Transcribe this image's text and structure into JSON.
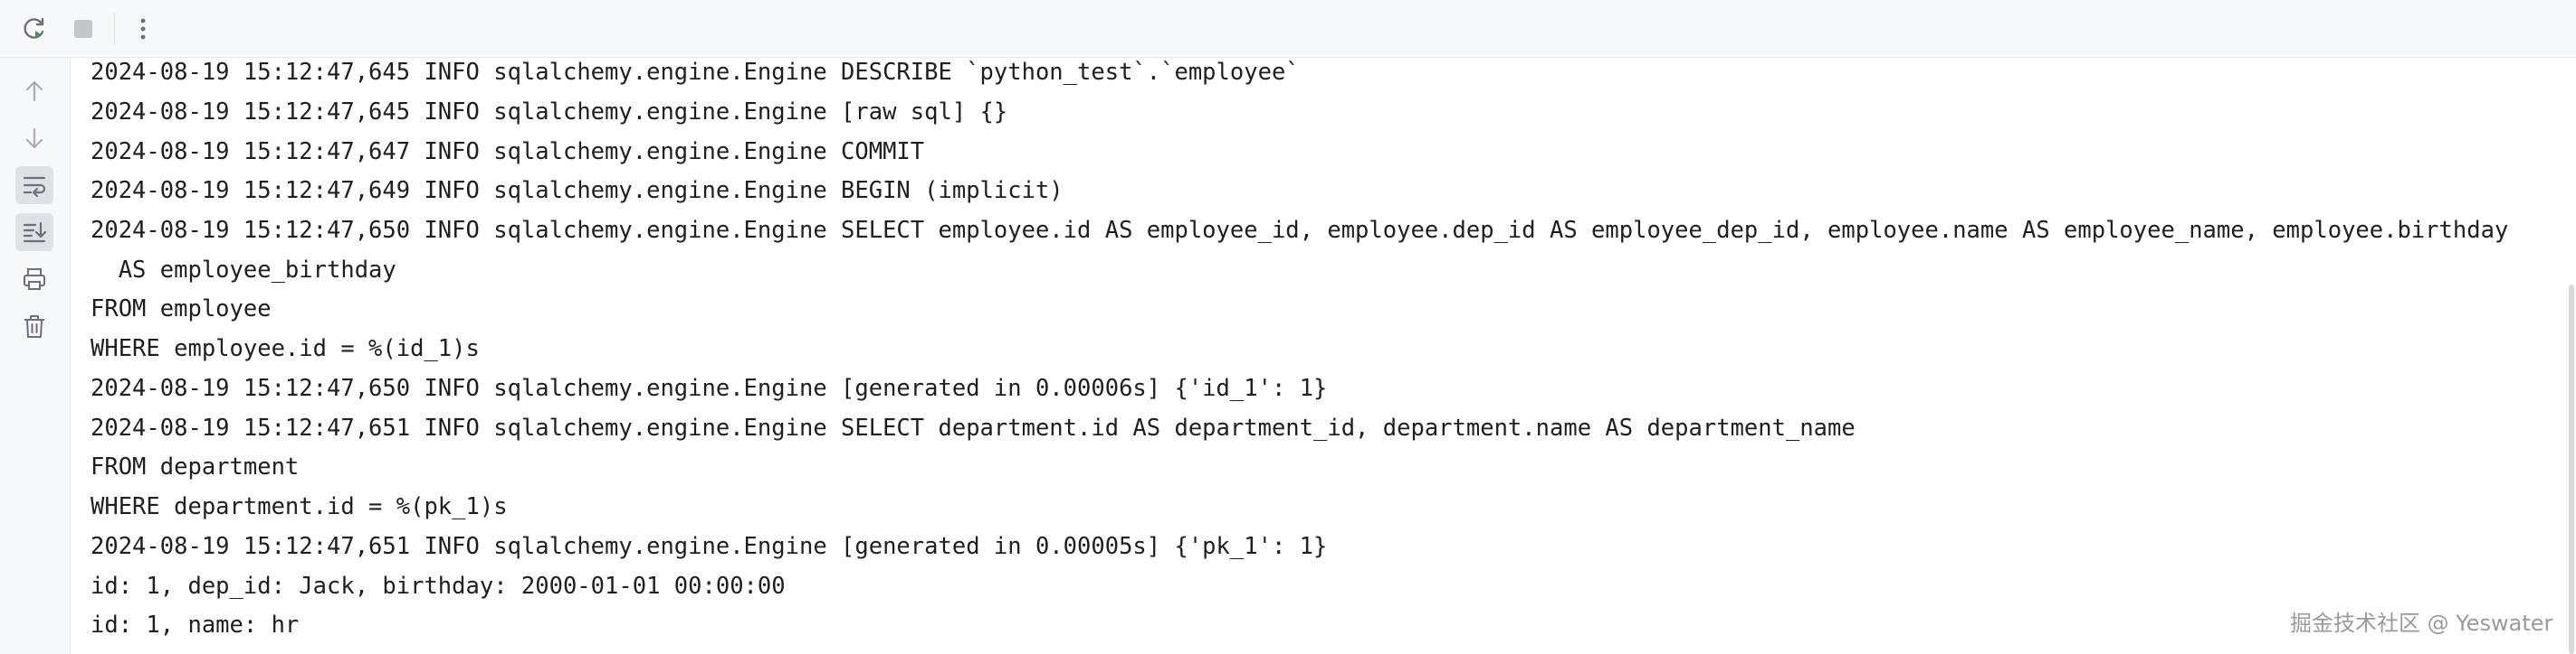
{
  "toolbar": {
    "rerun_icon": "rerun-icon",
    "stop_icon": "stop-icon",
    "more_icon": "more-vertical-icon"
  },
  "gutter": {
    "icons": [
      "arrow-up-icon",
      "arrow-down-icon",
      "soft-wrap-icon",
      "scroll-to-end-icon",
      "print-icon",
      "trash-icon"
    ]
  },
  "console": {
    "lines": [
      "2024-08-19 15:12:47,645 INFO sqlalchemy.engine.Engine DESCRIBE `python_test`.`employee`",
      "2024-08-19 15:12:47,645 INFO sqlalchemy.engine.Engine [raw sql] {}",
      "2024-08-19 15:12:47,647 INFO sqlalchemy.engine.Engine COMMIT",
      "2024-08-19 15:12:47,649 INFO sqlalchemy.engine.Engine BEGIN (implicit)",
      "2024-08-19 15:12:47,650 INFO sqlalchemy.engine.Engine SELECT employee.id AS employee_id, employee.dep_id AS employee_dep_id, employee.name AS employee_name, employee.birthday",
      "  AS employee_birthday",
      "FROM employee",
      "WHERE employee.id = %(id_1)s",
      "2024-08-19 15:12:47,650 INFO sqlalchemy.engine.Engine [generated in 0.00006s] {'id_1': 1}",
      "2024-08-19 15:12:47,651 INFO sqlalchemy.engine.Engine SELECT department.id AS department_id, department.name AS department_name",
      "FROM department",
      "WHERE department.id = %(pk_1)s",
      "2024-08-19 15:12:47,651 INFO sqlalchemy.engine.Engine [generated in 0.00005s] {'pk_1': 1}",
      "id: 1, dep_id: Jack, birthday: 2000-01-01 00:00:00",
      "id: 1, name: hr"
    ]
  },
  "watermark": "掘金技术社区 @ Yeswater"
}
